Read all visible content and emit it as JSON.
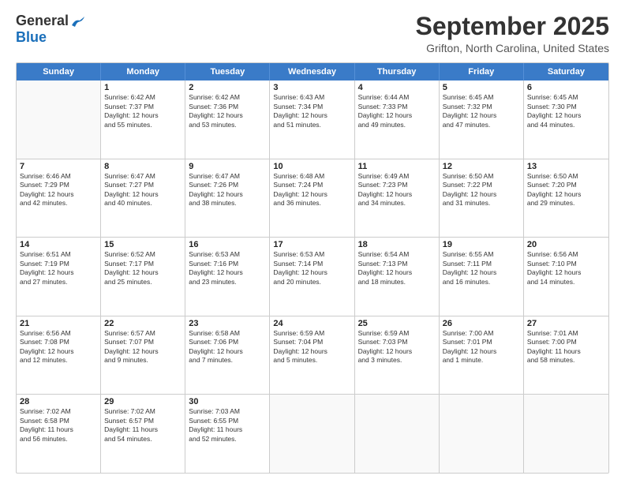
{
  "logo": {
    "general": "General",
    "blue": "Blue"
  },
  "title": "September 2025",
  "subtitle": "Grifton, North Carolina, United States",
  "days_of_week": [
    "Sunday",
    "Monday",
    "Tuesday",
    "Wednesday",
    "Thursday",
    "Friday",
    "Saturday"
  ],
  "weeks": [
    [
      {
        "day": "",
        "lines": []
      },
      {
        "day": "1",
        "lines": [
          "Sunrise: 6:42 AM",
          "Sunset: 7:37 PM",
          "Daylight: 12 hours",
          "and 55 minutes."
        ]
      },
      {
        "day": "2",
        "lines": [
          "Sunrise: 6:42 AM",
          "Sunset: 7:36 PM",
          "Daylight: 12 hours",
          "and 53 minutes."
        ]
      },
      {
        "day": "3",
        "lines": [
          "Sunrise: 6:43 AM",
          "Sunset: 7:34 PM",
          "Daylight: 12 hours",
          "and 51 minutes."
        ]
      },
      {
        "day": "4",
        "lines": [
          "Sunrise: 6:44 AM",
          "Sunset: 7:33 PM",
          "Daylight: 12 hours",
          "and 49 minutes."
        ]
      },
      {
        "day": "5",
        "lines": [
          "Sunrise: 6:45 AM",
          "Sunset: 7:32 PM",
          "Daylight: 12 hours",
          "and 47 minutes."
        ]
      },
      {
        "day": "6",
        "lines": [
          "Sunrise: 6:45 AM",
          "Sunset: 7:30 PM",
          "Daylight: 12 hours",
          "and 44 minutes."
        ]
      }
    ],
    [
      {
        "day": "7",
        "lines": [
          "Sunrise: 6:46 AM",
          "Sunset: 7:29 PM",
          "Daylight: 12 hours",
          "and 42 minutes."
        ]
      },
      {
        "day": "8",
        "lines": [
          "Sunrise: 6:47 AM",
          "Sunset: 7:27 PM",
          "Daylight: 12 hours",
          "and 40 minutes."
        ]
      },
      {
        "day": "9",
        "lines": [
          "Sunrise: 6:47 AM",
          "Sunset: 7:26 PM",
          "Daylight: 12 hours",
          "and 38 minutes."
        ]
      },
      {
        "day": "10",
        "lines": [
          "Sunrise: 6:48 AM",
          "Sunset: 7:24 PM",
          "Daylight: 12 hours",
          "and 36 minutes."
        ]
      },
      {
        "day": "11",
        "lines": [
          "Sunrise: 6:49 AM",
          "Sunset: 7:23 PM",
          "Daylight: 12 hours",
          "and 34 minutes."
        ]
      },
      {
        "day": "12",
        "lines": [
          "Sunrise: 6:50 AM",
          "Sunset: 7:22 PM",
          "Daylight: 12 hours",
          "and 31 minutes."
        ]
      },
      {
        "day": "13",
        "lines": [
          "Sunrise: 6:50 AM",
          "Sunset: 7:20 PM",
          "Daylight: 12 hours",
          "and 29 minutes."
        ]
      }
    ],
    [
      {
        "day": "14",
        "lines": [
          "Sunrise: 6:51 AM",
          "Sunset: 7:19 PM",
          "Daylight: 12 hours",
          "and 27 minutes."
        ]
      },
      {
        "day": "15",
        "lines": [
          "Sunrise: 6:52 AM",
          "Sunset: 7:17 PM",
          "Daylight: 12 hours",
          "and 25 minutes."
        ]
      },
      {
        "day": "16",
        "lines": [
          "Sunrise: 6:53 AM",
          "Sunset: 7:16 PM",
          "Daylight: 12 hours",
          "and 23 minutes."
        ]
      },
      {
        "day": "17",
        "lines": [
          "Sunrise: 6:53 AM",
          "Sunset: 7:14 PM",
          "Daylight: 12 hours",
          "and 20 minutes."
        ]
      },
      {
        "day": "18",
        "lines": [
          "Sunrise: 6:54 AM",
          "Sunset: 7:13 PM",
          "Daylight: 12 hours",
          "and 18 minutes."
        ]
      },
      {
        "day": "19",
        "lines": [
          "Sunrise: 6:55 AM",
          "Sunset: 7:11 PM",
          "Daylight: 12 hours",
          "and 16 minutes."
        ]
      },
      {
        "day": "20",
        "lines": [
          "Sunrise: 6:56 AM",
          "Sunset: 7:10 PM",
          "Daylight: 12 hours",
          "and 14 minutes."
        ]
      }
    ],
    [
      {
        "day": "21",
        "lines": [
          "Sunrise: 6:56 AM",
          "Sunset: 7:08 PM",
          "Daylight: 12 hours",
          "and 12 minutes."
        ]
      },
      {
        "day": "22",
        "lines": [
          "Sunrise: 6:57 AM",
          "Sunset: 7:07 PM",
          "Daylight: 12 hours",
          "and 9 minutes."
        ]
      },
      {
        "day": "23",
        "lines": [
          "Sunrise: 6:58 AM",
          "Sunset: 7:06 PM",
          "Daylight: 12 hours",
          "and 7 minutes."
        ]
      },
      {
        "day": "24",
        "lines": [
          "Sunrise: 6:59 AM",
          "Sunset: 7:04 PM",
          "Daylight: 12 hours",
          "and 5 minutes."
        ]
      },
      {
        "day": "25",
        "lines": [
          "Sunrise: 6:59 AM",
          "Sunset: 7:03 PM",
          "Daylight: 12 hours",
          "and 3 minutes."
        ]
      },
      {
        "day": "26",
        "lines": [
          "Sunrise: 7:00 AM",
          "Sunset: 7:01 PM",
          "Daylight: 12 hours",
          "and 1 minute."
        ]
      },
      {
        "day": "27",
        "lines": [
          "Sunrise: 7:01 AM",
          "Sunset: 7:00 PM",
          "Daylight: 11 hours",
          "and 58 minutes."
        ]
      }
    ],
    [
      {
        "day": "28",
        "lines": [
          "Sunrise: 7:02 AM",
          "Sunset: 6:58 PM",
          "Daylight: 11 hours",
          "and 56 minutes."
        ]
      },
      {
        "day": "29",
        "lines": [
          "Sunrise: 7:02 AM",
          "Sunset: 6:57 PM",
          "Daylight: 11 hours",
          "and 54 minutes."
        ]
      },
      {
        "day": "30",
        "lines": [
          "Sunrise: 7:03 AM",
          "Sunset: 6:55 PM",
          "Daylight: 11 hours",
          "and 52 minutes."
        ]
      },
      {
        "day": "",
        "lines": []
      },
      {
        "day": "",
        "lines": []
      },
      {
        "day": "",
        "lines": []
      },
      {
        "day": "",
        "lines": []
      }
    ]
  ]
}
